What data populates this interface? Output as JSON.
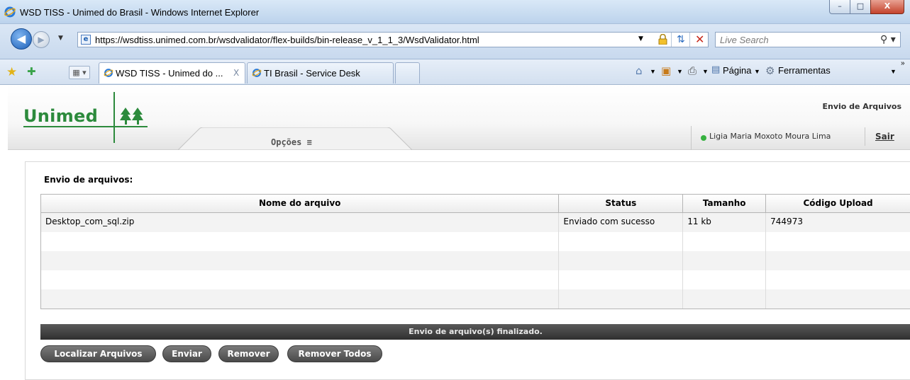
{
  "window": {
    "title": "WSD TISS - Unimed do Brasil - Windows Internet Explorer",
    "minimize": "–",
    "maximize": "□",
    "close": "X"
  },
  "address_bar": {
    "url": "https://wsdtiss.unimed.com.br/wsdvalidator/flex-builds/bin-release_v_1_1_3/WsdValidator.html",
    "search_placeholder": "Live Search"
  },
  "tabs": [
    {
      "label": "WSD TISS - Unimed do ...",
      "close": "X"
    },
    {
      "label": "TI Brasil - Service Desk"
    }
  ],
  "command_bar": {
    "page_menu": "Página",
    "tools_menu": "Ferramentas"
  },
  "header": {
    "logo_text": "Unimed",
    "menu_label": "Opções ≡",
    "page_title": "Envio de Arquivos",
    "user_name": "Ligia Maria Moxoto Moura Lima",
    "logout": "Sair"
  },
  "upload": {
    "section_title": "Envio de arquivos:",
    "columns": [
      "Nome do arquivo",
      "Status",
      "Tamanho",
      "Código Upload"
    ],
    "rows": [
      [
        "Desktop_com_sql.zip",
        "Enviado com sucesso",
        "11 kb",
        "744973"
      ],
      [
        "",
        "",
        "",
        ""
      ],
      [
        "",
        "",
        "",
        ""
      ],
      [
        "",
        "",
        "",
        ""
      ],
      [
        "",
        "",
        "",
        ""
      ]
    ],
    "status_message": "Envio de arquivo(s) finalizado.",
    "buttons": {
      "browse": "Localizar Arquivos",
      "send": "Enviar",
      "remove": "Remover",
      "remove_all": "Remover Todos"
    }
  },
  "colors": {
    "brand_green": "#2c8a3c",
    "status_bar": "#3a3a3a",
    "online_dot": "#36b13f"
  }
}
